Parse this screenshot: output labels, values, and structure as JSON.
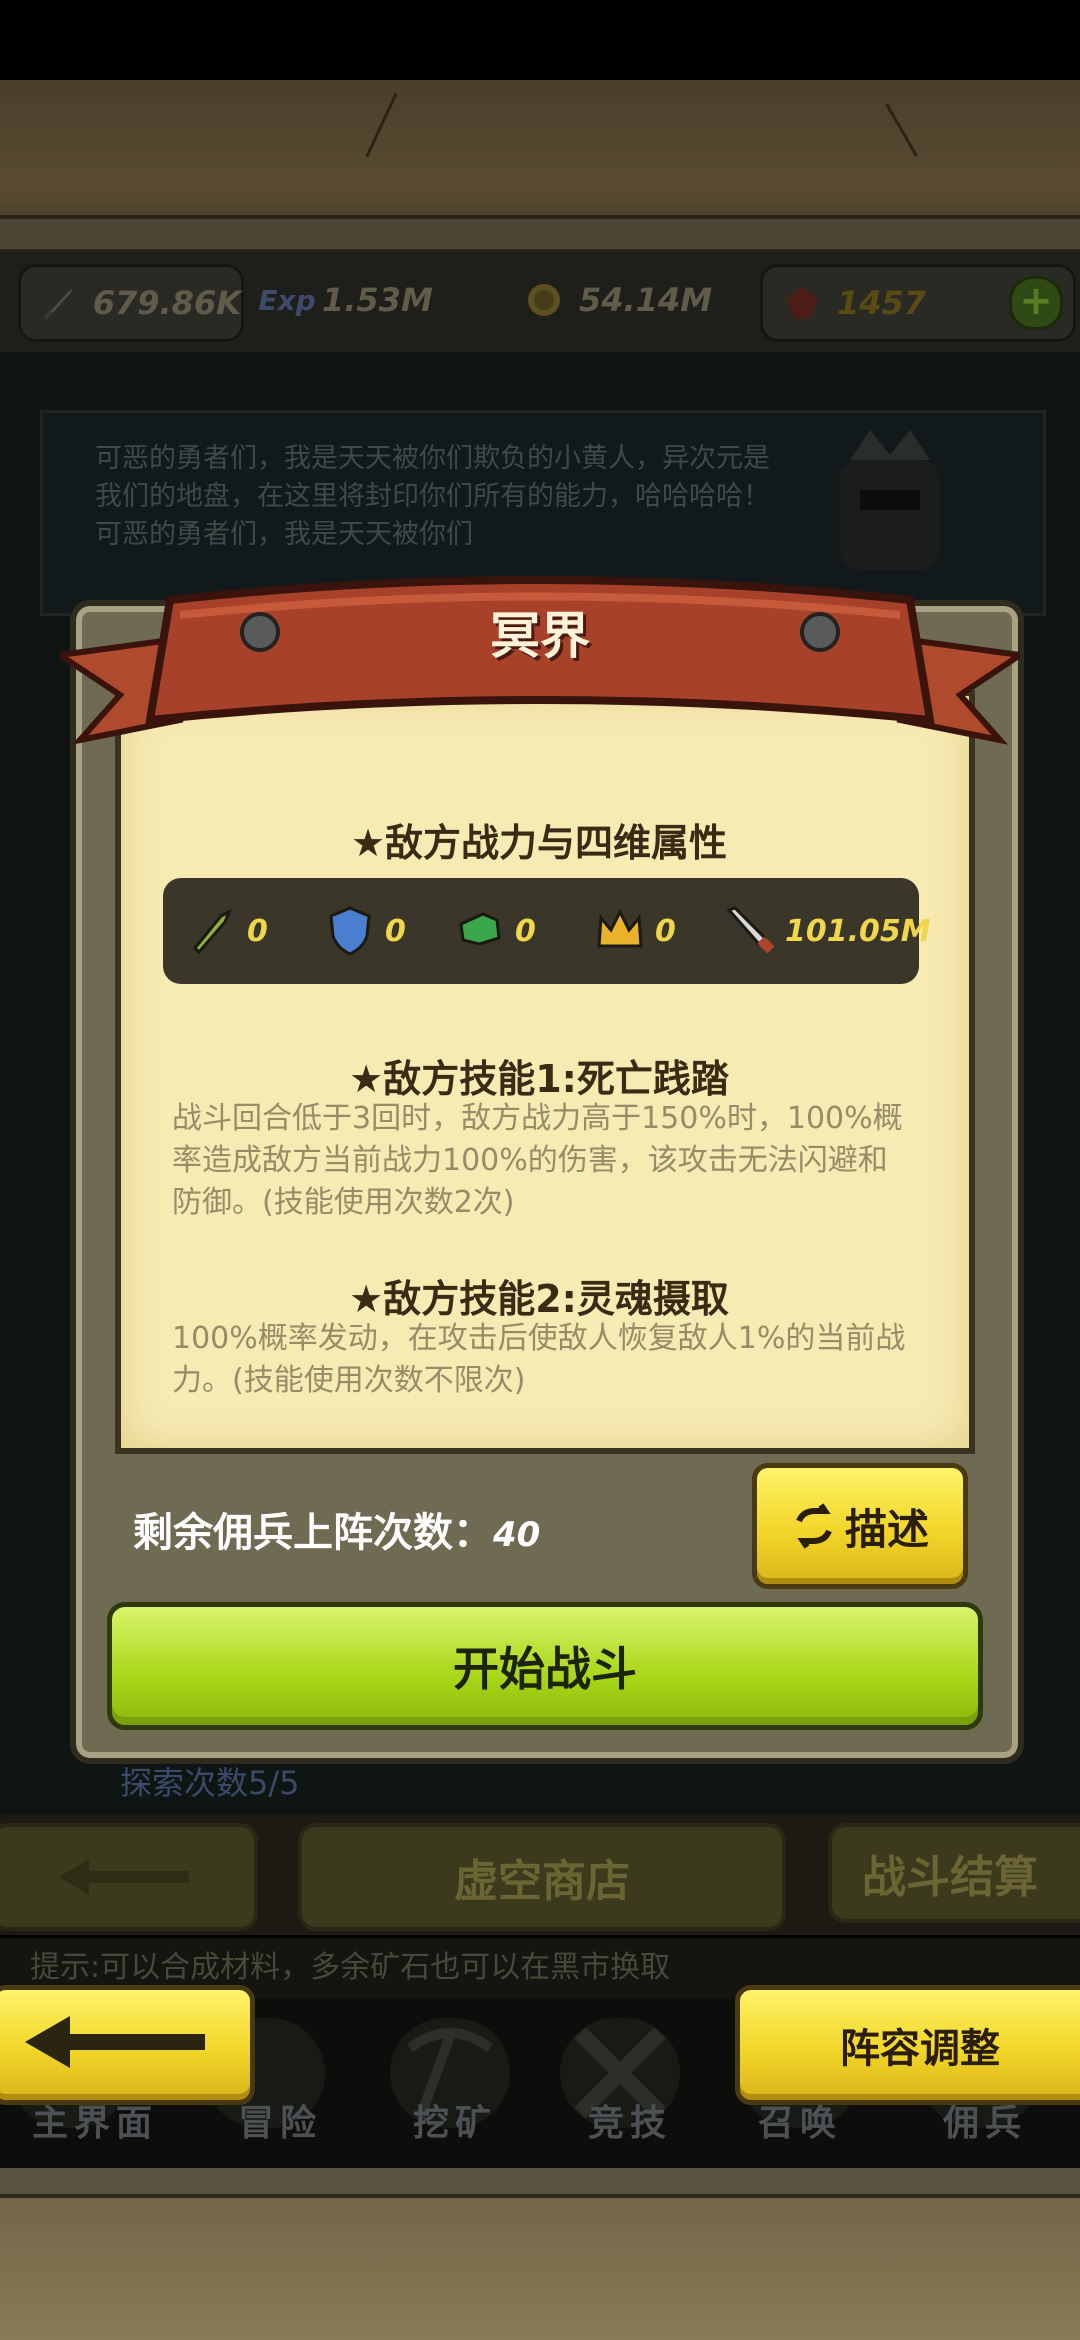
{
  "resources": {
    "power": "679.86K",
    "exp": "1.53M",
    "coins": "54.14M",
    "gems": "1457"
  },
  "boss_dialog": {
    "text": "可恶的勇者们，我是天天被你们欺负的小黄人，异次元是我们的地盘，在这里将封印你们所有的能力，哈哈哈哈！可恶的勇者们，我是天天被你们"
  },
  "modal": {
    "title": "冥界",
    "attributes_heading": "★敌方战力与四维属性",
    "attributes": {
      "attack": "0",
      "defense": "0",
      "agility": "0",
      "leadership": "0",
      "power": "101.05M"
    },
    "skill1_heading": "★敌方技能1:死亡践踏",
    "skill1_desc": "战斗回合低于3回时，敌方战力高于150%时，100%概率造成敌方当前战力100%的伤害，该攻击无法闪避和防御。(技能使用次数2次)",
    "skill2_heading": "★敌方技能2:灵魂摄取",
    "skill2_desc": "100%概率发动，在攻击后使敌人恢复敌人1%的当前战力。(技能使用次数不限次)",
    "remaining_label": "剩余佣兵上阵次数：",
    "remaining_value": "40",
    "describe_button": "描述",
    "start_button": "开始战斗"
  },
  "background": {
    "explore_count": "探索次数5/5",
    "void_shop": "虚空商店",
    "battle_result": "战斗结算",
    "tip": "提示:可以合成材料，多余矿石也可以在黑市换取"
  },
  "lineup_button": "阵容调整",
  "tabs": [
    "主界面",
    "冒险",
    "挖矿",
    "竞技",
    "召唤",
    "佣兵"
  ],
  "colors": {
    "banner_red": "#a8412a",
    "parchment": "#f7eab2",
    "start_green": "#a8d617",
    "button_yellow": "#f2d628"
  }
}
